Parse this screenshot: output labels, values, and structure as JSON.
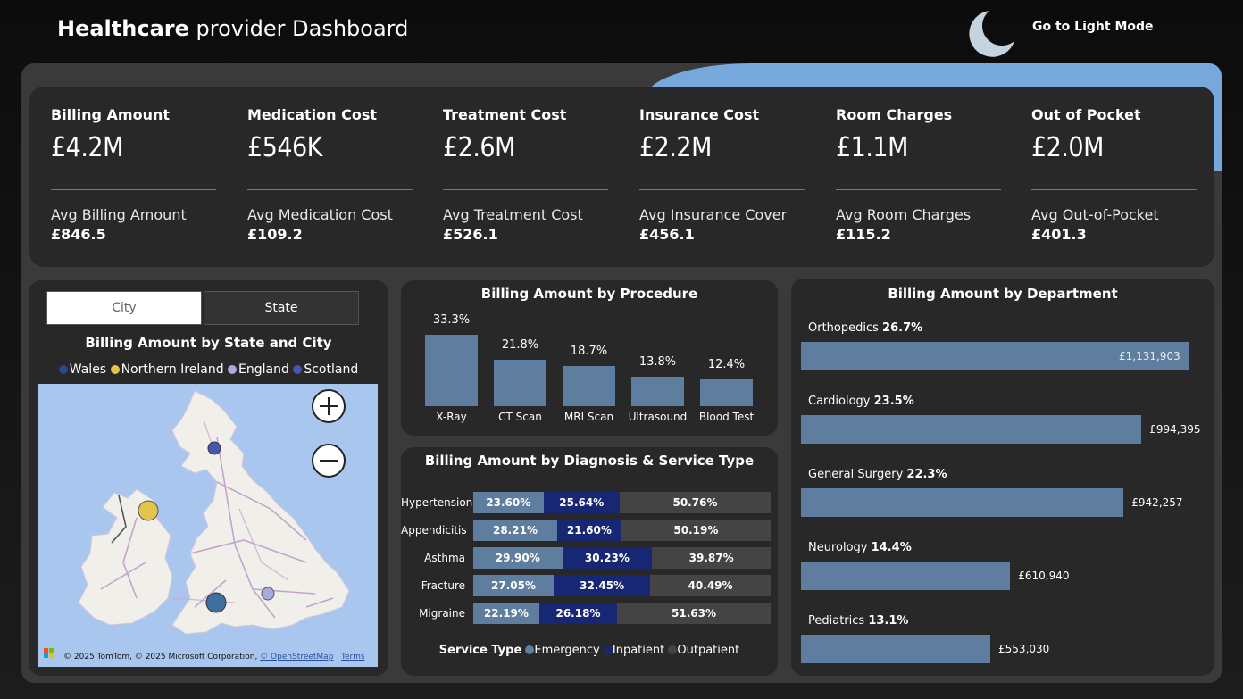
{
  "header": {
    "title_bold": "Healthcare",
    "title_rest": " provider Dashboard",
    "mode_label": "Go to Light Mode"
  },
  "kpis": [
    {
      "label": "Billing Amount",
      "value": "£4.2M",
      "avg_label": "Avg Billing Amount",
      "avg_value": "£846.5"
    },
    {
      "label": "Medication Cost",
      "value": "£546K",
      "avg_label": "Avg Medication Cost",
      "avg_value": "£109.2"
    },
    {
      "label": "Treatment Cost",
      "value": "£2.6M",
      "avg_label": "Avg Treatment Cost",
      "avg_value": "£526.1"
    },
    {
      "label": "Insurance Cost",
      "value": "£2.2M",
      "avg_label": "Avg Insurance Cover",
      "avg_value": "£456.1"
    },
    {
      "label": "Room Charges",
      "value": "£1.1M",
      "avg_label": "Avg Room Charges",
      "avg_value": "£115.2"
    },
    {
      "label": "Out of Pocket",
      "value": "£2.0M",
      "avg_label": "Avg Out-of-Pocket",
      "avg_value": "£401.3"
    }
  ],
  "map": {
    "toggle_city": "City",
    "toggle_state": "State",
    "title": "Billing Amount by State and City",
    "legend": [
      {
        "name": "Wales",
        "color": "#1f4e8a"
      },
      {
        "name": "Northern Ireland",
        "color": "#e3c44a"
      },
      {
        "name": "England",
        "color": "#a9a9e0"
      },
      {
        "name": "Scotland",
        "color": "#4656b3"
      }
    ],
    "credit": "© 2025 TomTom, © 2025 Microsoft Corporation, ",
    "credit_link": "© OpenStreetMap",
    "terms": "Terms"
  },
  "procedure": {
    "title": "Billing Amount by Procedure",
    "bar_color": "#5f7e9f",
    "items": [
      {
        "name": "X-Ray",
        "pct": 33.3,
        "label": "33.3%"
      },
      {
        "name": "CT Scan",
        "pct": 21.8,
        "label": "21.8%"
      },
      {
        "name": "MRI Scan",
        "pct": 18.7,
        "label": "18.7%"
      },
      {
        "name": "Ultrasound",
        "pct": 13.8,
        "label": "13.8%"
      },
      {
        "name": "Blood Test",
        "pct": 12.4,
        "label": "12.4%"
      }
    ]
  },
  "diagnosis": {
    "title": "Billing Amount by Diagnosis & Service Type",
    "legend_title": "Service Type",
    "series": [
      {
        "name": "Emergency",
        "color": "#5f7e9f"
      },
      {
        "name": "Inpatient",
        "color": "#172773"
      },
      {
        "name": "Outpatient",
        "color": "#444444"
      }
    ],
    "rows": [
      {
        "name": "Hypertension",
        "values": [
          23.6,
          25.64,
          50.76
        ],
        "labels": [
          "23.60%",
          "25.64%",
          "50.76%"
        ]
      },
      {
        "name": "Appendicitis",
        "values": [
          28.21,
          21.6,
          50.19
        ],
        "labels": [
          "28.21%",
          "21.60%",
          "50.19%"
        ]
      },
      {
        "name": "Asthma",
        "values": [
          29.9,
          30.23,
          39.87
        ],
        "labels": [
          "29.90%",
          "30.23%",
          "39.87%"
        ]
      },
      {
        "name": "Fracture",
        "values": [
          27.05,
          32.45,
          40.49
        ],
        "labels": [
          "27.05%",
          "32.45%",
          "40.49%"
        ]
      },
      {
        "name": "Migraine",
        "values": [
          22.19,
          26.18,
          51.63
        ],
        "labels": [
          "22.19%",
          "26.18%",
          "51.63%"
        ]
      }
    ]
  },
  "department": {
    "title": "Billing Amount by Department",
    "items": [
      {
        "name": "Orthopedics",
        "pct": "26.7%",
        "value": 1131903,
        "value_label": "£1,131,903"
      },
      {
        "name": "Cardiology",
        "pct": "23.5%",
        "value": 994395,
        "value_label": "£994,395"
      },
      {
        "name": "General Surgery",
        "pct": "22.3%",
        "value": 942257,
        "value_label": "£942,257"
      },
      {
        "name": "Neurology",
        "pct": "14.4%",
        "value": 610940,
        "value_label": "£610,940"
      },
      {
        "name": "Pediatrics",
        "pct": "13.1%",
        "value": 553030,
        "value_label": "£553,030"
      }
    ]
  }
}
